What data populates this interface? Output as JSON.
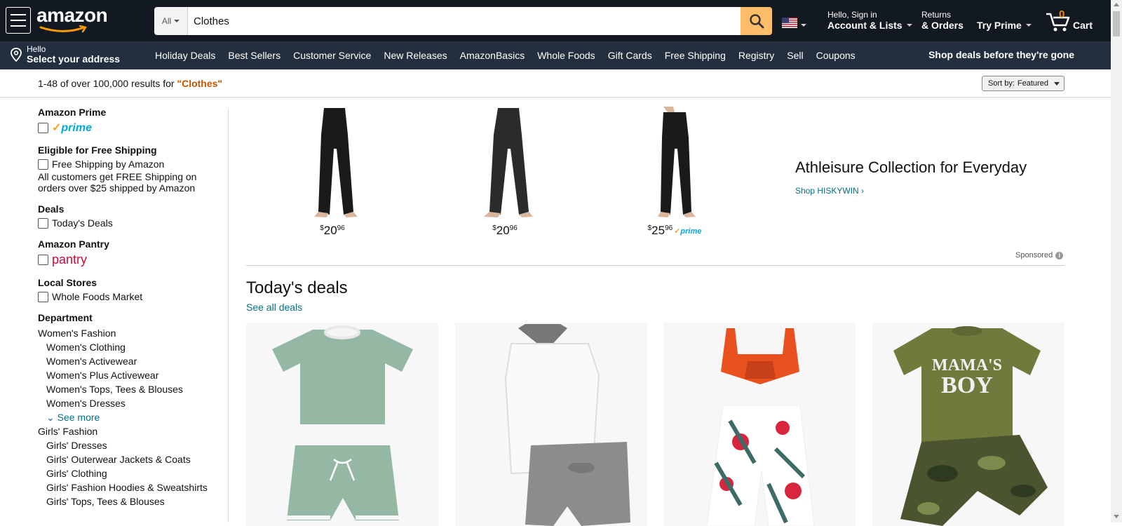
{
  "header": {
    "logo": "amazon",
    "search": {
      "category": "All",
      "query": "Clothes"
    },
    "account": {
      "line1": "Hello, Sign in",
      "line2": "Account & Lists"
    },
    "returns": {
      "line1": "Returns",
      "line2": "& Orders"
    },
    "prime": "Try Prime",
    "cart": {
      "count": "0",
      "label": "Cart"
    }
  },
  "subnav": {
    "address": {
      "line1": "Hello",
      "line2": "Select your address"
    },
    "items": [
      "Holiday Deals",
      "Best Sellers",
      "Customer Service",
      "New Releases",
      "AmazonBasics",
      "Whole Foods",
      "Gift Cards",
      "Free Shipping",
      "Registry",
      "Sell",
      "Coupons"
    ],
    "promo": "Shop deals before they're gone"
  },
  "results": {
    "count_text": "1-48 of over 100,000 results for ",
    "query": "\"Clothes\"",
    "sort_label": "Sort by:",
    "sort_value": "Featured"
  },
  "sidebar": {
    "prime_title": "Amazon Prime",
    "prime_logo": "prime",
    "shipping_title": "Eligible for Free Shipping",
    "shipping_option": "Free Shipping by Amazon",
    "shipping_note": "All customers get FREE Shipping on orders over $25 shipped by Amazon",
    "deals_title": "Deals",
    "deals_option": "Today's Deals",
    "pantry_title": "Amazon Pantry",
    "pantry_logo": "pantry",
    "stores_title": "Local Stores",
    "stores_option": "Whole Foods Market",
    "dept_title": "Department",
    "dept": {
      "women": "Women's Fashion",
      "women_items": [
        "Women's Clothing",
        "Women's Activewear",
        "Women's Plus Activewear",
        "Women's Tops, Tees & Blouses",
        "Women's Dresses"
      ],
      "see_more": "See more",
      "girls": "Girls' Fashion",
      "girls_items": [
        "Girls' Dresses",
        "Girls' Outerwear Jackets & Coats",
        "Girls' Clothing",
        "Girls' Fashion Hoodies & Sweatshirts",
        "Girls' Tops, Tees & Blouses"
      ]
    }
  },
  "sponsored": {
    "products": [
      {
        "price_whole": "20",
        "price_frac": "96",
        "prime": false
      },
      {
        "price_whole": "20",
        "price_frac": "96",
        "prime": false
      },
      {
        "price_whole": "25",
        "price_frac": "96",
        "prime": true
      }
    ],
    "currency": "$",
    "headline": "Athleisure Collection for Everyday",
    "link": "Shop HISKYWIN",
    "sponsored_label": "Sponsored",
    "prime_badge": "prime"
  },
  "deals": {
    "title": "Today's deals",
    "link": "See all deals",
    "card4_text_1": "MAMA'S",
    "card4_text_2": "BOY"
  },
  "colors": {
    "nav_dark": "#131921",
    "nav_sub": "#232F3E",
    "search_button": "#FEBD69",
    "link": "#007185",
    "query_orange": "#C45500",
    "prime_blue": "#00A8E1",
    "cart_orange": "#F08804"
  }
}
